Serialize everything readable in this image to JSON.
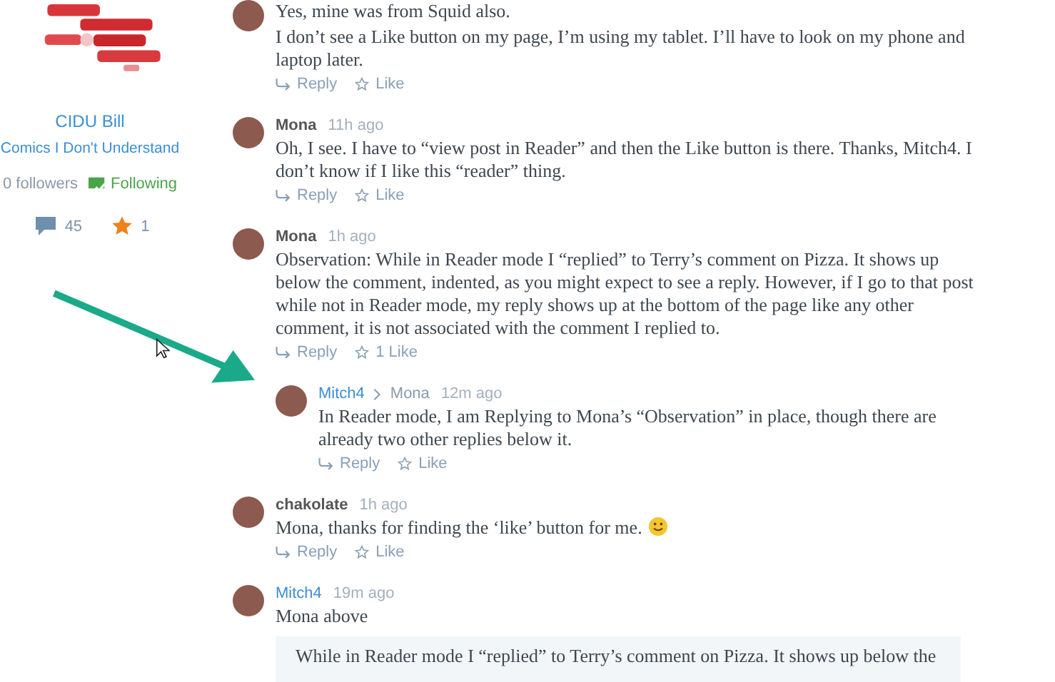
{
  "sidebar": {
    "name": "CIDU Bill",
    "blog": "Comics I Don't Understand",
    "followers": "0 followers",
    "following": {
      "label": "Following",
      "on": true
    },
    "comments_count": "45",
    "likes_count": "1"
  },
  "comments": [
    {
      "text": [
        "Yes, mine was from Squid also.",
        "I don’t see a Like button on my page, I’m using my tablet. I’ll have to look on my phone and laptop later."
      ],
      "reply_label": "Reply",
      "like_label": "Like"
    },
    {
      "author": "Mona",
      "time": "11h ago",
      "own": false,
      "text": [
        "Oh, I see. I have to “view post in Reader” and then the Like button is there. Thanks, Mitch4. I don’t know if I like this “reader” thing."
      ],
      "reply_label": "Reply",
      "like_label": "Like"
    },
    {
      "author": "Mona",
      "time": "1h ago",
      "own": false,
      "text": [
        "Observation: While in Reader mode I “replied” to Terry’s comment on Pizza. It shows up below the comment, indented, as you might expect to see a reply. However, if I go to that post while not in Reader mode, my reply shows up at the bottom of the page like any other comment, it is not associated with the comment I replied to."
      ],
      "reply_label": "Reply",
      "like_label": "1 Like",
      "children": [
        {
          "author": "Mitch4",
          "reply_to": "Mona",
          "time": "12m ago",
          "own": true,
          "text": [
            "In Reader mode, I am Replying to Mona’s “Observation” in place, though there are already two other replies below it."
          ],
          "reply_label": "Reply",
          "like_label": "Like"
        }
      ]
    },
    {
      "author": "chakolate",
      "time": "1h ago",
      "own": false,
      "text": [
        "Mona, thanks for finding the ‘like’ button for me."
      ],
      "trailing_emoji": true,
      "reply_label": "Reply",
      "like_label": "Like"
    },
    {
      "author": "Mitch4",
      "time": "19m ago",
      "own": true,
      "text": [
        "Mona above"
      ],
      "quote": "While in Reader mode I “replied” to Terry’s comment on Pizza. It shows up below the"
    }
  ]
}
